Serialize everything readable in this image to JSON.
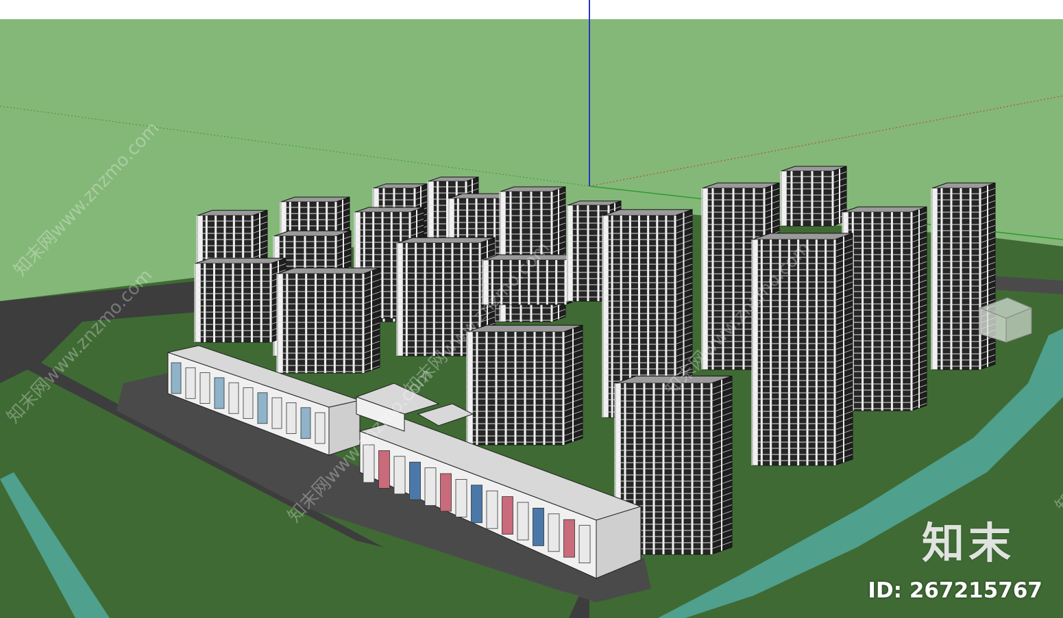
{
  "viewport": {
    "colors": {
      "sky_top": "#ffffff",
      "ground_plane": "#84b878",
      "lawn": "#3f6a34",
      "road": "#3d3d3d",
      "river": "#4fa08c",
      "facade_light": "#f2f2f2",
      "facade_dark": "#242424",
      "roof": "#8e8e8e",
      "axis_blue": "#2a34c8",
      "axis_red": "#c0392b",
      "axis_green": "#2e9a2e"
    }
  },
  "watermark": {
    "text": "知末网www.znzmo.com",
    "brand": "知末",
    "id_label": "ID: 267215767"
  }
}
